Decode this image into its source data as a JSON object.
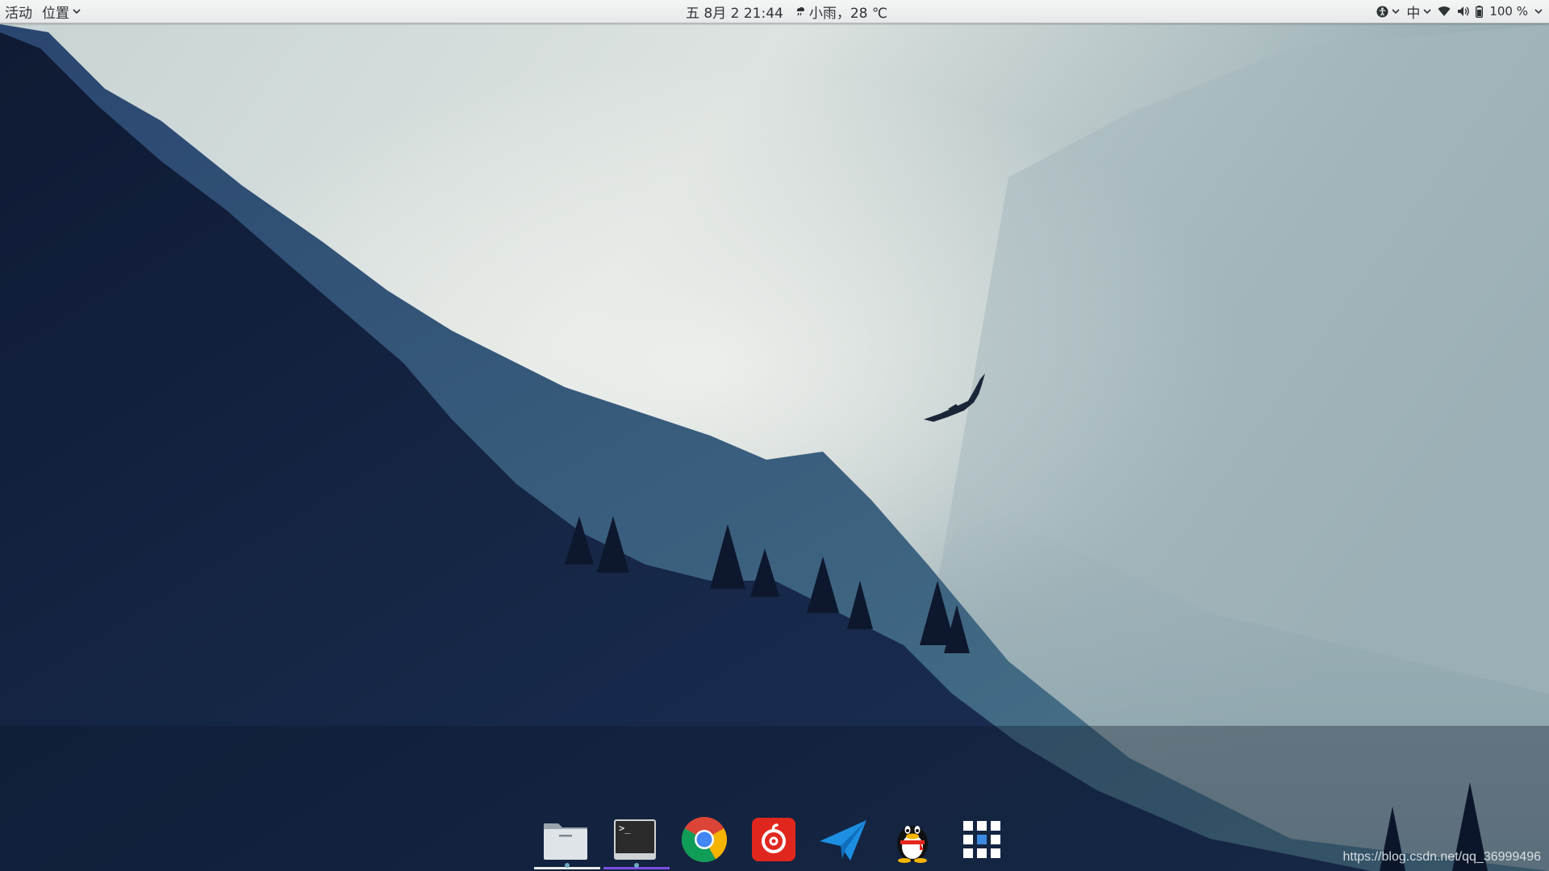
{
  "topbar": {
    "activities_label": "活动",
    "places_label": "位置",
    "clock": "五 8月 2  21:44",
    "weather_text": "小雨，28 ℃",
    "input_method": "中",
    "battery_percent": "100 %"
  },
  "dock": {
    "items": [
      {
        "name": "files",
        "icon": "folder-icon"
      },
      {
        "name": "terminal",
        "icon": "terminal-icon",
        "prompt": ">_"
      },
      {
        "name": "chrome",
        "icon": "chrome-icon"
      },
      {
        "name": "netease-music",
        "icon": "netease-music-icon"
      },
      {
        "name": "feishu-send",
        "icon": "paper-plane-icon"
      },
      {
        "name": "qq",
        "icon": "qq-penguin-icon"
      },
      {
        "name": "show-applications",
        "icon": "app-grid-icon"
      }
    ]
  },
  "watermark": "https://blog.csdn.net/qq_36999496",
  "colors": {
    "topbar_bg": "#ececec",
    "sky": "#cdd8d8",
    "forest_dark": "#0c1528",
    "terminal_indicator": "#7d4ee0",
    "files_indicator": "#e9eef0",
    "netease_red": "#e0271e",
    "send_blue": "#1d8fe1"
  }
}
